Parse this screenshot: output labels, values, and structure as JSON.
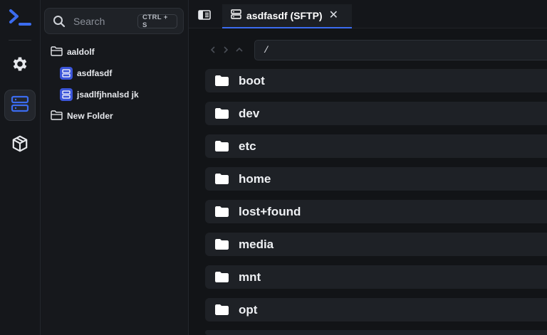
{
  "rail": {
    "logo_icon": "terminal-prompt-icon",
    "items": [
      {
        "icon": "gear-icon"
      },
      {
        "icon": "server-icon",
        "active": true
      },
      {
        "icon": "package-icon"
      }
    ],
    "accent": "#3b6cf0"
  },
  "sidebar": {
    "search_placeholder": "Search",
    "search_shortcut": "CTRL + S",
    "tree": [
      {
        "type": "folder",
        "label": "aaldolf",
        "depth": 0
      },
      {
        "type": "server",
        "label": "asdfasdf",
        "depth": 1
      },
      {
        "type": "server",
        "label": "jsadlfjhnalsd jk",
        "depth": 1
      },
      {
        "type": "folder",
        "label": "New Folder",
        "depth": 0
      }
    ]
  },
  "tabs": [
    {
      "title": "asdfasdf (SFTP)",
      "icon": "server-icon",
      "active": true
    }
  ],
  "navbar": {
    "path": "/"
  },
  "files": [
    {
      "name": "boot"
    },
    {
      "name": "dev"
    },
    {
      "name": "etc"
    },
    {
      "name": "home"
    },
    {
      "name": "lost+found"
    },
    {
      "name": "media"
    },
    {
      "name": "mnt"
    },
    {
      "name": "opt"
    },
    {
      "name": ""
    }
  ]
}
